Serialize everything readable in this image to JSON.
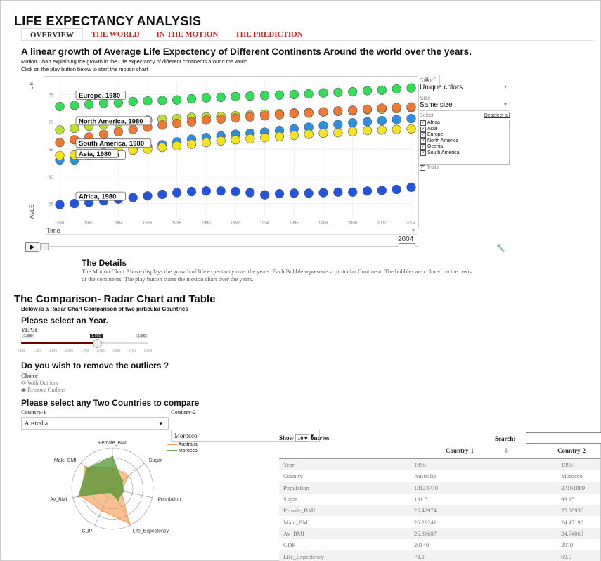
{
  "app": {
    "title": "LIFE EXPECTANCY ANALYSIS"
  },
  "tabs": [
    {
      "label": "OVERVIEW"
    },
    {
      "label": "THE WORLD"
    },
    {
      "label": "IN THE MOTION"
    },
    {
      "label": "THE PREDICTION"
    }
  ],
  "overview": {
    "heading": "A linear growth of Average Life Expectency of Different Continents Around the world over the years.",
    "caption1": "Motion Chart explaining the growth in the Life expectancy of different continents around the world",
    "caption2": "Click on the play button below to start the motion chart"
  },
  "motion_chart": {
    "y_axis_label": "AvLE",
    "y_axis_label_top": "Lin",
    "x_axis_select": "Time",
    "current_year": "2004",
    "series_labels": [
      "Europe, 1980",
      "North America, 1980",
      "South America, 1980",
      "Ocenia, 1980",
      "Asia, 1980",
      "Africa, 1980"
    ]
  },
  "side_panel": {
    "color_label": "Color",
    "color_value": "Unique colors",
    "size_label": "Size",
    "size_value": "Same size",
    "select_label": "Select",
    "deselect_label": "Deselect all",
    "items": [
      "Africa",
      "Asia",
      "Europe",
      "North America",
      "Ocenia",
      "South America"
    ],
    "trails_label": "Trails"
  },
  "details": {
    "heading": "The Details",
    "text": "The Motion Chart Above displays the growth of life expectancy over the years. Each Bubble represents a pirticular Continent. The bubbles are colored on the basis of the continents. The play button starts the motion chart over the years."
  },
  "comparison": {
    "heading": "The Comparison- Radar Chart and Table",
    "caption": "Below is a Radar Chart Comparison of two pirticular Countries",
    "year_heading": "Please select an Year.",
    "year_label": "YEAR",
    "year_min": "1,980",
    "year_max": "2,005",
    "year_value": "1,995",
    "year_fraction": 0.6,
    "year_ticks": [
      "1,980",
      "1,983",
      "1,986",
      "1,989",
      "1,992",
      "1,995",
      "1,998",
      "2,001",
      "2,004"
    ],
    "outliers_heading": "Do you wish to remove the outliers ?",
    "choice_label": "Choice",
    "choice_options": [
      "With Outliers",
      "Remove Outliers"
    ],
    "countries_heading": "Please select any Two Countries to compare",
    "country1_label": "Country-1",
    "country1_value": "Australia",
    "country2_label": "Country-2",
    "country2_value": "Morocco"
  },
  "radar": {
    "axes": [
      "Female_BMI",
      "Sugar",
      "Population",
      "Life_Expectency",
      "GDP",
      "Av_BMI",
      "Male_BMI"
    ],
    "legend": [
      {
        "name": "Australia",
        "color": "#f5a05a"
      },
      {
        "name": "Morocco",
        "color": "#6aa84f"
      }
    ]
  },
  "table": {
    "show_label": "Show",
    "show_value": "10",
    "entries_label": "entries",
    "search_label": "Search:",
    "headers": [
      "",
      "Country-1",
      "Country-2"
    ],
    "rows": [
      [
        "Year",
        "1995",
        "1995"
      ],
      [
        "Country",
        "Australia",
        "Morocco"
      ],
      [
        "Population",
        "18124770",
        "27161889"
      ],
      [
        "Sugar",
        "131.51",
        "93.15"
      ],
      [
        "Female_BMI",
        "25.47974",
        "25.60936"
      ],
      [
        "Male_BMI",
        "26.29241",
        "24.47190"
      ],
      [
        "Av_BMI",
        "25.88607",
        "24.74063"
      ],
      [
        "GDP",
        "20140",
        "2070"
      ],
      [
        "Life_Expectency",
        "78.2",
        "69.0"
      ]
    ]
  },
  "chart_data": {
    "type": "scatter",
    "x_ticks": [
      "1980",
      "1982",
      "1984",
      "1986",
      "1988",
      "1990",
      "1992",
      "1994",
      "1996",
      "1998",
      "2000",
      "2002",
      "2004"
    ],
    "y_ticks": [
      "55",
      "60",
      "65",
      "70",
      "75"
    ],
    "ylim": [
      52.5,
      77.5
    ],
    "xlim": [
      1980,
      2004
    ],
    "series": [
      {
        "name": "Europe",
        "color": "#33dd55",
        "values": [
          72.8,
          73.0,
          73.2,
          73.4,
          73.5,
          73.7,
          73.8,
          73.9,
          74.0,
          74.2,
          74.4,
          74.5,
          74.6,
          74.7,
          74.8,
          74.9,
          75.0,
          75.1,
          75.3,
          75.4,
          75.5,
          75.7,
          75.8,
          76.0,
          76.2
        ]
      },
      {
        "name": "North America",
        "color": "#bbe033",
        "values": [
          68.5,
          68.8,
          69.2,
          69.5,
          69.8,
          70.1,
          70.3,
          70.5,
          70.6,
          70.8,
          70.9,
          71.0,
          71.1,
          71.2,
          71.4,
          71.5,
          71.6,
          71.7,
          71.8,
          71.9,
          72.0,
          72.2,
          72.3,
          72.4,
          72.6
        ]
      },
      {
        "name": "South America",
        "color": "#f07830",
        "values": [
          66.2,
          66.7,
          67.2,
          67.7,
          68.2,
          68.6,
          69.0,
          69.4,
          69.7,
          70.0,
          70.3,
          70.5,
          70.7,
          70.9,
          71.1,
          71.3,
          71.5,
          71.6,
          71.8,
          72.0,
          72.1,
          72.3,
          72.5,
          72.6,
          72.7
        ]
      },
      {
        "name": "Ocenia",
        "color": "#2e8ee0",
        "values": [
          63.0,
          63.0,
          63.8,
          64.2,
          64.6,
          65.0,
          65.4,
          65.8,
          66.3,
          66.8,
          67.1,
          67.4,
          67.7,
          67.9,
          68.1,
          68.4,
          68.7,
          69.0,
          69.3,
          69.5,
          69.8,
          70.0,
          70.2,
          70.4,
          70.6
        ]
      },
      {
        "name": "Asia",
        "color": "#f2e220",
        "values": [
          63.8,
          63.9,
          64.0,
          64.3,
          64.6,
          64.8,
          65.0,
          65.3,
          65.6,
          65.9,
          66.2,
          66.5,
          66.7,
          66.9,
          67.1,
          67.3,
          67.5,
          67.7,
          67.9,
          68.0,
          68.2,
          68.4,
          68.5,
          68.6,
          68.7
        ]
      },
      {
        "name": "Africa",
        "color": "#2255dd",
        "values": [
          54.8,
          55.0,
          55.2,
          55.5,
          55.8,
          56.1,
          56.4,
          56.7,
          57.0,
          57.2,
          57.3,
          57.3,
          57.2,
          57.0,
          56.6,
          56.8,
          56.9,
          56.9,
          57.0,
          57.1,
          57.1,
          57.3,
          57.4,
          57.6,
          58.0
        ]
      }
    ]
  },
  "radar_data": {
    "type": "radar",
    "axes": [
      "Female_BMI",
      "Sugar",
      "Population",
      "Life_Expectency",
      "GDP",
      "Av_BMI",
      "Male_BMI"
    ],
    "series": [
      {
        "name": "Australia",
        "values": [
          0.52,
          0.5,
          0.22,
          0.95,
          0.6,
          0.8,
          0.85
        ]
      },
      {
        "name": "Morocco",
        "values": [
          0.78,
          0.3,
          0.28,
          0.3,
          0.1,
          0.85,
          0.8
        ]
      }
    ]
  }
}
